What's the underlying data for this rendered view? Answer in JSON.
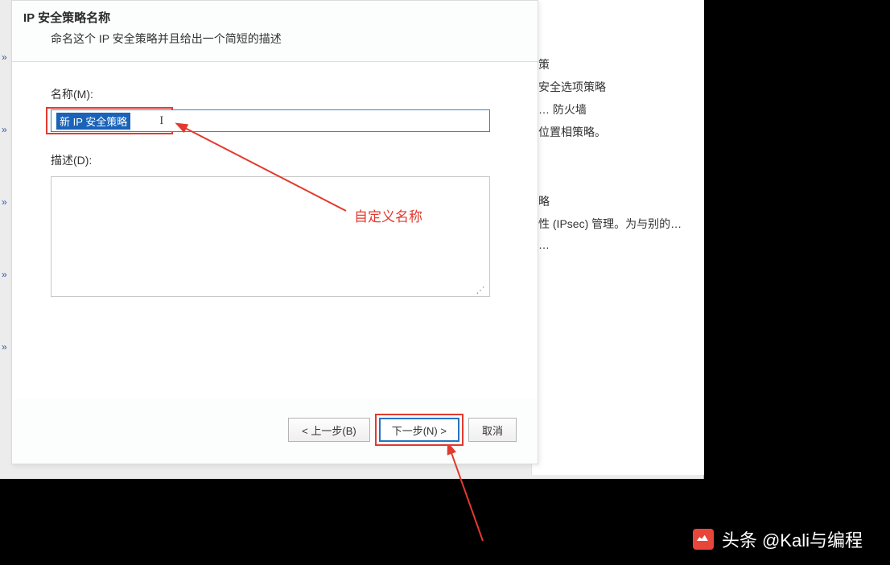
{
  "dialog": {
    "title": "IP 安全策略名称",
    "subtitle": "命名这个 IP 安全策略并且给出一个简短的描述",
    "name_label": "名称(M):",
    "name_value": "新 IP 安全策略",
    "desc_label": "描述(D):",
    "desc_value": ""
  },
  "buttons": {
    "back": "< 上一步(B)",
    "next": "下一步(N) >",
    "cancel": "取消"
  },
  "annotation": {
    "custom_name": "自定义名称"
  },
  "background_panel": {
    "lines": [
      "策",
      "安全选项策略",
      "… 防火墙",
      "位置相策略。",
      "",
      "略",
      "性 (IPsec) 管理。为与别的…",
      "…"
    ]
  },
  "watermark": {
    "text": "头条 @Kali与编程"
  },
  "left_markers": [
    "»",
    "»",
    "»",
    "»",
    "»"
  ]
}
